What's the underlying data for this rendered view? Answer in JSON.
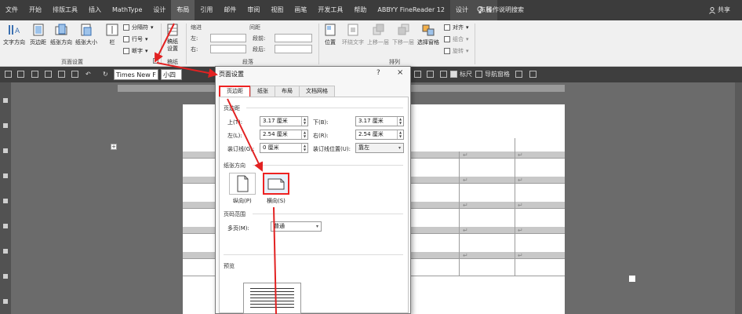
{
  "menubar": {
    "tabs": [
      "文件",
      "开始",
      "排版工具",
      "插入",
      "MathType",
      "设计",
      "布局",
      "引用",
      "邮件",
      "审阅",
      "视图",
      "画笔",
      "开发工具",
      "帮助",
      "ABBYY FineReader 12",
      "设计",
      "布局"
    ],
    "help": "操作说明搜索",
    "share": "共享"
  },
  "ribbon": {
    "buttons": [
      "文字方向",
      "页边距",
      "纸张方向",
      "纸张大小",
      "栏"
    ],
    "small": [
      "分隔符",
      "行号",
      "断字"
    ],
    "group_page_setup": "页面设置",
    "manuscript_btn": "稿纸\n设置",
    "group_manuscript": "稿纸",
    "indent_head": "缩进",
    "spacing_head": "间距",
    "indent_left": "左:",
    "indent_right": "右:",
    "space_before": "段前:",
    "space_after": "段后:",
    "group_paragraph": "段落",
    "arrange_buttons": [
      "位置",
      "环绕文字",
      "上移一层",
      "下移一层",
      "选择窗格"
    ],
    "arrange_small": [
      "对齐",
      "组合",
      "旋转"
    ],
    "group_arrange": "排列"
  },
  "qbar": {
    "font": "Times New F",
    "size": "小四",
    "ruler_label": "标尺",
    "nav_label": "导航窗格"
  },
  "doc": {
    "return_mark": "↵"
  },
  "dialog": {
    "title": "页面设置",
    "help": "?",
    "close": "×",
    "tabs": [
      "页边距",
      "纸张",
      "布局",
      "文档网格"
    ],
    "margins_section": "页边距",
    "top_label": "上(T):",
    "top_value": "3.17 厘米",
    "bottom_label": "下(B):",
    "bottom_value": "3.17 厘米",
    "left_label": "左(L):",
    "left_value": "2.54 厘米",
    "right_label": "右(R):",
    "right_value": "2.54 厘米",
    "gutter_label": "装订线(G):",
    "gutter_value": "0 厘米",
    "gutter_pos_label": "装订线位置(U):",
    "gutter_pos_value": "靠左",
    "orientation_section": "纸张方向",
    "portrait_label": "纵向(P)",
    "landscape_label": "横向(S)",
    "pages_section": "页码范围",
    "multi_pages_label": "多页(M):",
    "multi_pages_value": "普通",
    "preview_section": "预览"
  },
  "colors": {
    "highlight": "#e22222"
  }
}
